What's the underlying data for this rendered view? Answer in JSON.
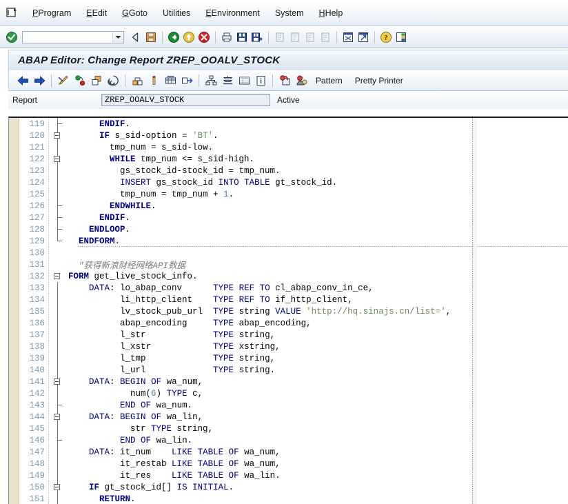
{
  "menu": {
    "logo_icon": "sap-window-icon",
    "items": [
      {
        "label": "Program",
        "accel": "P"
      },
      {
        "label": "Edit",
        "accel": "E"
      },
      {
        "label": "Goto",
        "accel": "G"
      },
      {
        "label": "Utilities",
        "accel": "U"
      },
      {
        "label": "Environment",
        "accel": "E"
      },
      {
        "label": "System",
        "accel": "y"
      },
      {
        "label": "Help",
        "accel": "H"
      }
    ]
  },
  "system_toolbar": {
    "enter_icon": "green-check-enter-icon",
    "command_field": {
      "value": "",
      "placeholder": ""
    },
    "dropdown_icon": "chevron-down-icon",
    "buttons": [
      {
        "name": "back-arrow-icon",
        "label": "Back"
      },
      {
        "name": "save-floppy-icon",
        "label": "Save"
      },
      {
        "name": "back-green-icon",
        "label": "Back"
      },
      {
        "name": "exit-yellow-icon",
        "label": "Exit"
      },
      {
        "name": "cancel-red-icon",
        "label": "Cancel"
      },
      {
        "name": "print-icon",
        "label": "Print"
      },
      {
        "name": "find-icon",
        "label": "Find"
      },
      {
        "name": "find-next-icon",
        "label": "Find Next"
      },
      {
        "name": "first-page-icon",
        "label": "First Page"
      },
      {
        "name": "previous-page-icon",
        "label": "Previous Page"
      },
      {
        "name": "next-page-icon",
        "label": "Next Page"
      },
      {
        "name": "last-page-icon",
        "label": "Last Page"
      },
      {
        "name": "create-session-icon",
        "label": "Create Session"
      },
      {
        "name": "create-shortcut-icon",
        "label": "Create Shortcut"
      },
      {
        "name": "help-icon",
        "label": "Help"
      },
      {
        "name": "customize-layout-icon",
        "label": "Customize Local Layout"
      }
    ]
  },
  "app": {
    "title": "ABAP Editor: Change Report ZREP_OOALV_STOCK",
    "toolbar": {
      "icons": [
        {
          "name": "back-blue-arrow-icon",
          "label": "Display Previous"
        },
        {
          "name": "forward-blue-arrow-icon",
          "label": "Display Next"
        },
        {
          "name": "check-syntax-icon",
          "label": "Check"
        },
        {
          "name": "activate-icon",
          "label": "Activate"
        },
        {
          "name": "copy-object-icon",
          "label": "Copy"
        },
        {
          "name": "trace-icon",
          "label": "Trace"
        },
        {
          "name": "where-used-icon",
          "label": "Where-Used List"
        },
        {
          "name": "breakpoint-icon",
          "label": "Breakpoint"
        },
        {
          "name": "display-object-list-icon",
          "label": "Display Object List"
        },
        {
          "name": "navigate-icon",
          "label": "Navigate"
        },
        {
          "name": "object-structure-icon",
          "label": "Object Structure"
        },
        {
          "name": "stack-icon",
          "label": "Stack"
        },
        {
          "name": "table-display-icon",
          "label": "Table Display"
        },
        {
          "name": "information-icon",
          "label": "Information"
        },
        {
          "name": "display-change-icon",
          "label": "Display / Change"
        },
        {
          "name": "debug-user-icon",
          "label": "Debugging"
        }
      ],
      "pattern_label": "Pattern",
      "pretty_printer_label": "Pretty Printer"
    }
  },
  "report_bar": {
    "label": "Report",
    "value": "ZREP_OOALV_STOCK",
    "status": "Active"
  },
  "editor": {
    "first_line": 119,
    "lines": [
      {
        "n": 119,
        "fold": "tick",
        "v": true,
        "html": "      <span class=\"kw\">ENDIF</span>."
      },
      {
        "n": 120,
        "fold": "box",
        "v": true,
        "html": "      <span class=\"kw\">IF</span> s_sid-option = <span class=\"lit\">'BT'</span>."
      },
      {
        "n": 121,
        "fold": "line",
        "v": true,
        "html": "        tmp_num = s_sid-low."
      },
      {
        "n": 122,
        "fold": "box",
        "v": true,
        "html": "        <span class=\"kw\">WHILE</span> tmp_num &lt;= s_sid-high."
      },
      {
        "n": 123,
        "fold": "line",
        "v": true,
        "html": "          gs_stock_id-stock_id = tmp_num."
      },
      {
        "n": 124,
        "fold": "line",
        "v": true,
        "html": "          <span class=\"kw2\">INSERT</span> gs_stock_id <span class=\"kw2\">INTO</span> <span class=\"kw2\">TABLE</span> gt_stock_id."
      },
      {
        "n": 125,
        "fold": "line",
        "v": true,
        "html": "          tmp_num = tmp_num + <span class=\"num\">1</span>."
      },
      {
        "n": 126,
        "fold": "tick",
        "v": true,
        "html": "        <span class=\"kw\">ENDWHILE</span>."
      },
      {
        "n": 127,
        "fold": "tick",
        "v": true,
        "html": "      <span class=\"kw\">ENDIF</span>."
      },
      {
        "n": 128,
        "fold": "tick",
        "v": true,
        "html": "    <span class=\"kw\">ENDLOOP</span>."
      },
      {
        "n": 129,
        "fold": "lcorner",
        "v": false,
        "html": "  <span class=\"kw\">ENDFORM</span>.",
        "sep": true
      },
      {
        "n": 130,
        "fold": "none",
        "v": false,
        "html": ""
      },
      {
        "n": 131,
        "fold": "none",
        "v": false,
        "html": "  <span class=\"cmt\">\"获得新浪财经网络API数据</span>"
      },
      {
        "n": 132,
        "fold": "box",
        "v": false,
        "html": "<span class=\"frm\">FORM</span> get_live_stock_info."
      },
      {
        "n": 133,
        "fold": "line",
        "v": true,
        "html": "    <span class=\"kw2\">DATA</span>: lo_abap_conv      <span class=\"kw2\">TYPE</span> <span class=\"kw2\">REF</span> <span class=\"kw2\">TO</span> cl_abap_conv_in_ce,"
      },
      {
        "n": 134,
        "fold": "line",
        "v": true,
        "html": "          li_http_client    <span class=\"kw2\">TYPE</span> <span class=\"kw2\">REF</span> <span class=\"kw2\">TO</span> if_http_client,"
      },
      {
        "n": 135,
        "fold": "line",
        "v": true,
        "html": "          lv_stock_pub_url  <span class=\"kw2\">TYPE</span> string <span class=\"kw2\">VALUE</span> <span class=\"lit\">'http://hq.sinajs.cn/list='</span>,"
      },
      {
        "n": 136,
        "fold": "line",
        "v": true,
        "html": "          abap_encoding     <span class=\"kw2\">TYPE</span> abap_encoding,"
      },
      {
        "n": 137,
        "fold": "line",
        "v": true,
        "html": "          l_str             <span class=\"kw2\">TYPE</span> string,"
      },
      {
        "n": 138,
        "fold": "line",
        "v": true,
        "html": "          l_xstr            <span class=\"kw2\">TYPE</span> xstring,"
      },
      {
        "n": 139,
        "fold": "line",
        "v": true,
        "html": "          l_tmp             <span class=\"kw2\">TYPE</span> string,"
      },
      {
        "n": 140,
        "fold": "line",
        "v": true,
        "html": "          l_url             <span class=\"kw2\">TYPE</span> string."
      },
      {
        "n": 141,
        "fold": "box",
        "v": true,
        "html": "    <span class=\"kw2\">DATA</span>: <span class=\"kw2\">BEGIN</span> <span class=\"kw2\">OF</span> wa_num,"
      },
      {
        "n": 142,
        "fold": "line",
        "v": true,
        "html": "            num(<span class=\"num\">6</span>) <span class=\"kw2\">TYPE</span> c,"
      },
      {
        "n": 143,
        "fold": "tick",
        "v": true,
        "html": "          <span class=\"kw2\">END</span> <span class=\"kw2\">OF</span> wa_num."
      },
      {
        "n": 144,
        "fold": "box",
        "v": true,
        "html": "    <span class=\"kw2\">DATA</span>: <span class=\"kw2\">BEGIN</span> <span class=\"kw2\">OF</span> wa_lin,"
      },
      {
        "n": 145,
        "fold": "line",
        "v": true,
        "html": "            str <span class=\"kw2\">TYPE</span> string,"
      },
      {
        "n": 146,
        "fold": "tick",
        "v": true,
        "html": "          <span class=\"kw2\">END</span> <span class=\"kw2\">OF</span> wa_lin."
      },
      {
        "n": 147,
        "fold": "line",
        "v": true,
        "html": "    <span class=\"kw2\">DATA</span>: it_num    <span class=\"kw2\">LIKE</span> <span class=\"kw2\">TABLE</span> <span class=\"kw2\">OF</span> wa_num,"
      },
      {
        "n": 148,
        "fold": "line",
        "v": true,
        "html": "          it_restab <span class=\"kw2\">LIKE</span> <span class=\"kw2\">TABLE</span> <span class=\"kw2\">OF</span> wa_num,"
      },
      {
        "n": 149,
        "fold": "line",
        "v": true,
        "html": "          it_res    <span class=\"kw2\">LIKE</span> <span class=\"kw2\">TABLE</span> <span class=\"kw2\">OF</span> wa_lin."
      },
      {
        "n": 150,
        "fold": "box",
        "v": true,
        "html": "    <span class=\"kw\">IF</span> gt_stock_id[] <span class=\"kw2\">IS</span> <span class=\"kw2\">INITIAL</span>."
      },
      {
        "n": 151,
        "fold": "line",
        "v": true,
        "html": "      <span class=\"kw\">RETURN</span>."
      }
    ]
  },
  "colors": {
    "accent_blue": "#000080",
    "comment_gray": "#7a7a7a",
    "string_green": "#6d8764",
    "gutter_beige": "#e8e2cc",
    "linenum_blue": "#7f98ab"
  }
}
